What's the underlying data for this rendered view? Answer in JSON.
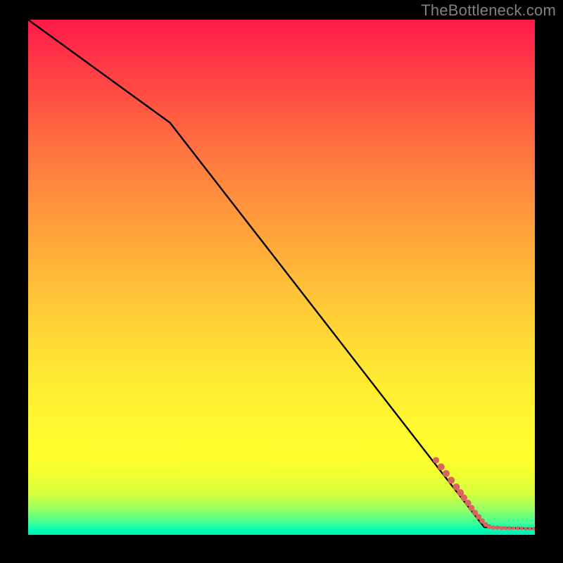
{
  "watermark": "TheBottleneck.com",
  "chart_data": {
    "type": "line",
    "title": "",
    "xlabel": "",
    "ylabel": "",
    "xlim": [
      0,
      100
    ],
    "ylim": [
      0,
      100
    ],
    "grid": false,
    "legend": false,
    "gradient_stops": [
      {
        "pos": 0,
        "color": "#ff1a49"
      },
      {
        "pos": 0.22,
        "color": "#ff6941"
      },
      {
        "pos": 0.45,
        "color": "#ffad3a"
      },
      {
        "pos": 0.68,
        "color": "#ffe733"
      },
      {
        "pos": 0.84,
        "color": "#fffe2e"
      },
      {
        "pos": 0.95,
        "color": "#97ff63"
      },
      {
        "pos": 1.0,
        "color": "#00eab0"
      }
    ],
    "series": [
      {
        "name": "curve",
        "x": [
          0,
          28,
          90,
          100
        ],
        "y": [
          100,
          80,
          1.5,
          1.2
        ]
      }
    ],
    "markers": {
      "name": "highlighted-points",
      "color": "#d9635f",
      "points": [
        {
          "x": 80.5,
          "y": 14.5,
          "r": 4.5
        },
        {
          "x": 81.5,
          "y": 13.2,
          "r": 5.0
        },
        {
          "x": 82.5,
          "y": 11.9,
          "r": 5.0
        },
        {
          "x": 83.5,
          "y": 10.6,
          "r": 5.0
        },
        {
          "x": 84.5,
          "y": 9.3,
          "r": 5.0
        },
        {
          "x": 85.3,
          "y": 8.2,
          "r": 5.0
        },
        {
          "x": 86.0,
          "y": 7.2,
          "r": 4.8
        },
        {
          "x": 86.8,
          "y": 6.2,
          "r": 4.6
        },
        {
          "x": 87.5,
          "y": 5.2,
          "r": 4.4
        },
        {
          "x": 88.2,
          "y": 4.3,
          "r": 4.2
        },
        {
          "x": 88.9,
          "y": 3.5,
          "r": 4.0
        },
        {
          "x": 89.6,
          "y": 2.7,
          "r": 3.8
        },
        {
          "x": 90.3,
          "y": 2.0,
          "r": 3.6
        },
        {
          "x": 91.0,
          "y": 1.6,
          "r": 3.4
        },
        {
          "x": 91.8,
          "y": 1.4,
          "r": 3.2
        },
        {
          "x": 92.6,
          "y": 1.4,
          "r": 3.0
        },
        {
          "x": 93.4,
          "y": 1.3,
          "r": 3.0
        },
        {
          "x": 94.2,
          "y": 1.3,
          "r": 2.8
        },
        {
          "x": 95.0,
          "y": 1.3,
          "r": 2.8
        },
        {
          "x": 95.8,
          "y": 1.3,
          "r": 2.6
        },
        {
          "x": 96.6,
          "y": 1.3,
          "r": 2.6
        },
        {
          "x": 97.4,
          "y": 1.3,
          "r": 2.6
        },
        {
          "x": 98.2,
          "y": 1.2,
          "r": 2.6
        },
        {
          "x": 99.0,
          "y": 1.2,
          "r": 2.6
        },
        {
          "x": 99.8,
          "y": 1.2,
          "r": 2.6
        }
      ]
    }
  }
}
